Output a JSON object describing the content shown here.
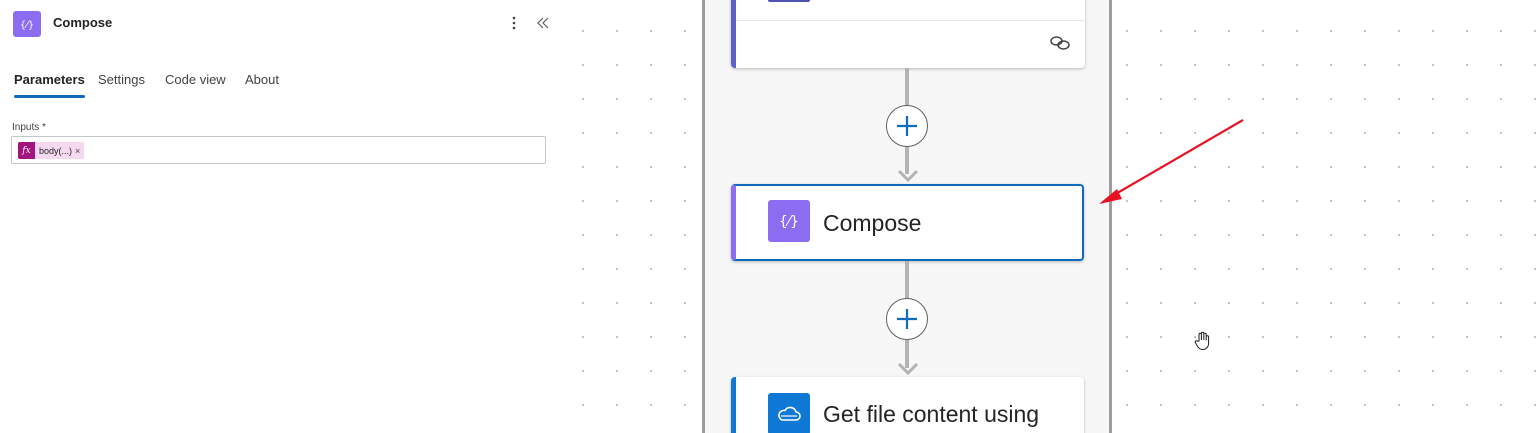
{
  "panel": {
    "title": "Compose",
    "icon": "compose-braces-icon",
    "more_icon": "more-vertical-icon",
    "collapse_icon": "double-chevron-left-icon",
    "tabs": [
      {
        "label": "Parameters",
        "active": true
      },
      {
        "label": "Settings",
        "active": false
      },
      {
        "label": "Code view",
        "active": false
      },
      {
        "label": "About",
        "active": false
      }
    ],
    "inputs": {
      "label": "Inputs *",
      "token": {
        "fx": "fx",
        "text": "body(...)",
        "remove": "×"
      }
    }
  },
  "canvas": {
    "cards": [
      {
        "id": "previous-action",
        "title": "",
        "icon": "link-icon",
        "accent": "#5b5fc7"
      },
      {
        "id": "compose",
        "title": "Compose",
        "icon": "compose-braces-icon",
        "accent": "#8c6cf0",
        "selected": true
      },
      {
        "id": "get-file-content",
        "title": "Get file content using",
        "icon": "onedrive-cloud-icon",
        "accent": "#0f78d4"
      }
    ],
    "insert_buttons": [
      "plus-icon",
      "plus-icon"
    ],
    "annotation": "red-arrow",
    "cursor": "hand-cursor-icon"
  },
  "colors": {
    "compose_purple": "#8c6cf0",
    "selection_blue": "#0f6cbd",
    "onedrive_blue": "#0f78d4",
    "expression_token": "#a4147e",
    "annotation_red": "#e81123"
  }
}
